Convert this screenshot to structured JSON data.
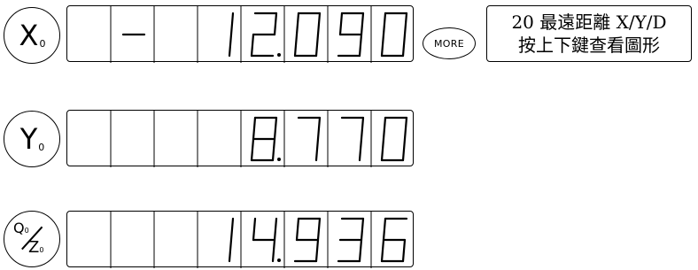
{
  "axes": [
    {
      "id": "x",
      "label": "X",
      "sub": "0",
      "value": "-12.090",
      "digits": [
        "-",
        "",
        "1",
        "2.",
        "0",
        "9",
        "0"
      ]
    },
    {
      "id": "y",
      "label": "Y",
      "sub": "0",
      "value": "8.770",
      "digits": [
        "",
        "",
        "",
        "",
        "8.",
        "7",
        "7",
        "0"
      ]
    },
    {
      "id": "qz",
      "label_top": "Q",
      "label_bottom": "Z",
      "sub": "0",
      "value": "14.936",
      "digits": [
        "",
        "",
        "1",
        "4.",
        "9",
        "3",
        "6"
      ]
    }
  ],
  "more_button": {
    "label": "MORE"
  },
  "info": {
    "line1": "20 最遠距離 X/Y/D",
    "line2": "按上下鍵查看圖形"
  },
  "colors": {
    "segment": "#000000",
    "cell_border": "#000000",
    "background": "#ffffff"
  }
}
